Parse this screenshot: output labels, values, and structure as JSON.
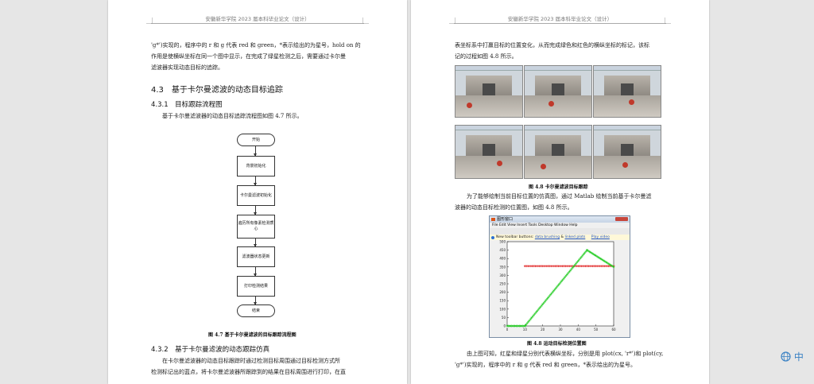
{
  "left_page": {
    "header": "安徽新华学院 2023 届本科毕业论文（设计）",
    "para1": [
      "'g*')实现的，程序中的 r 和 g 代表 red 和 green，*表示绘出的为星号，hold on 的",
      "作用是使横纵坐标在同一个图中显示，在完成了绿星检测之后，需要通过卡尔曼",
      "滤波器实现动态目标的追踪。"
    ],
    "section_4_3": "4.3　基于卡尔曼滤波的动态目标追踪",
    "section_4_3_1": "4.3.1　目标跟踪流程图",
    "intro_4_3_1": "基于卡尔曼滤波器的动态目标追踪流程图如图 4.7 所示。",
    "flow": {
      "start": "开始",
      "step1": "背景初始化",
      "step2": "卡尔曼滤波初始化",
      "step3": "遍历所有像素检测质心",
      "step4": "滤波器状态更新",
      "step5": "打印检测结果",
      "end": "结束"
    },
    "fig_4_7_caption": "图 4.7  基于卡尔曼滤波的目标跟踪流程图",
    "section_4_3_2": "4.3.2　基于卡尔曼滤波的动态跟踪仿真",
    "para2": [
      "在卡尔曼滤波器的动态目标跟踪时通过检测目标周围通过目标检测方式所",
      "检测标记出的蓝点，将卡尔曼滤波器所跟踪到的结果在目标周围进行打印，在直"
    ]
  },
  "right_page": {
    "header": "安徽新华学院 2023 届本科毕业论文（设计）",
    "para1": [
      "表坐标系中打赢目标的位置变化，从而完成绿色和红色的横纵坐标的标记，该标",
      "记的过程如图 4.8 所示。"
    ],
    "fig_4_8_caption": "图 4.8  卡尔曼滤波目标跟踪",
    "para2": [
      "为了能够绘制当前目标位置的仿真图，通过 Matlab 绘制当前基于卡尔曼滤",
      "波器的动态目标检测的位置图，如图 4.8 所示。"
    ],
    "matlab": {
      "title": "图形窗口",
      "menu": "File  Edit  View  Insert  Tools  Desktop  Window  Help",
      "info_prefix": "New toolbar buttons:",
      "info_link1": "data brushing",
      "info_and": "&",
      "info_link2": "linked plots",
      "info_link3": "Play video"
    },
    "fig_4_9_caption": "图 4.8  运动目标检测位置图",
    "para3": [
      "由上图可知，红星和绿星分别代表横纵坐标，分别是用 plot(cx, 'r*')和 plot(cy,",
      "'g*')实现的，程序中的 r 和 g 代表 red 和 green，*表示绘出的为星号。"
    ]
  },
  "chart_data": {
    "type": "scatter",
    "xlim": [
      0,
      60
    ],
    "ylim": [
      0,
      500
    ],
    "xticks": [
      "0",
      "10",
      "20",
      "30",
      "40",
      "50",
      "60"
    ],
    "yticks": [
      "0",
      "50",
      "100",
      "150",
      "200",
      "250",
      "300",
      "350",
      "400",
      "450",
      "500"
    ],
    "series": [
      {
        "color": "#e02020",
        "marker": "*",
        "x_from": 10,
        "x_to": 60,
        "y": 355,
        "points": 50
      },
      {
        "color": "#22cc22",
        "marker": "*",
        "segments": [
          [
            0,
            0,
            10,
            0
          ],
          [
            10,
            0,
            45,
            450
          ],
          [
            45,
            450,
            60,
            350
          ]
        ]
      }
    ]
  },
  "side_control": {
    "globe_icon": "globe-icon",
    "label": "中"
  }
}
